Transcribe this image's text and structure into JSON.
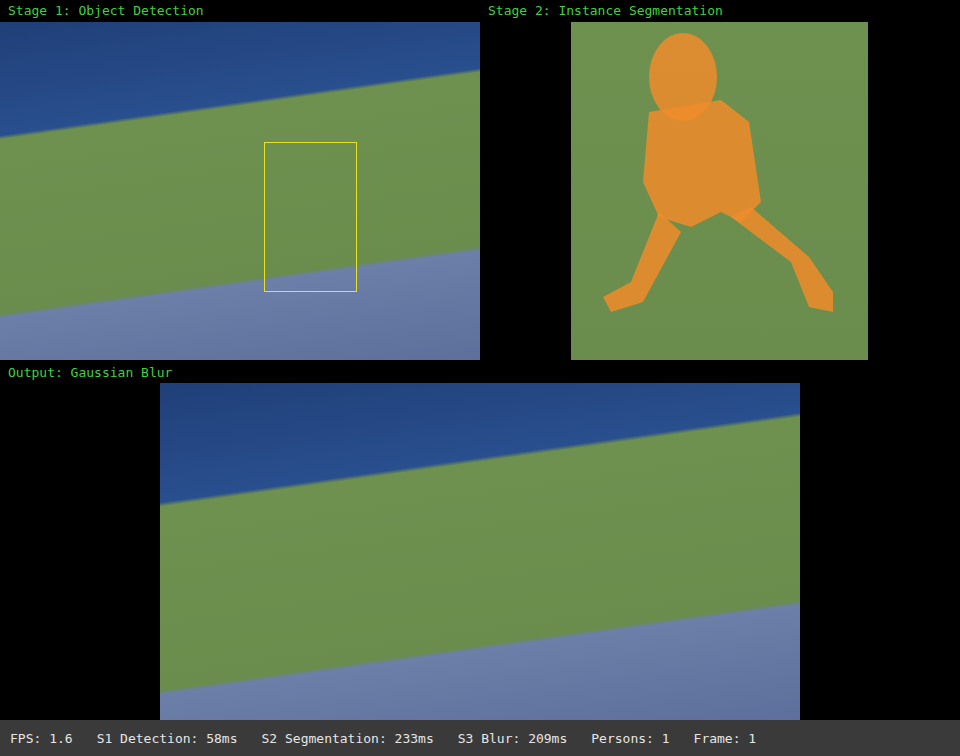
{
  "panels": {
    "detection": {
      "label": "Stage 1: Object Detection"
    },
    "segmentation": {
      "label": "Stage 2: Instance Segmentation"
    },
    "output": {
      "label": "Output: Gaussian Blur"
    }
  },
  "status_bar": [
    "FPS: 1.6",
    "S1 Detection: 58ms",
    "S2 Segmentation: 233ms",
    "S3 Blur: 209ms",
    "Persons: 1",
    "Frame: 1"
  ]
}
